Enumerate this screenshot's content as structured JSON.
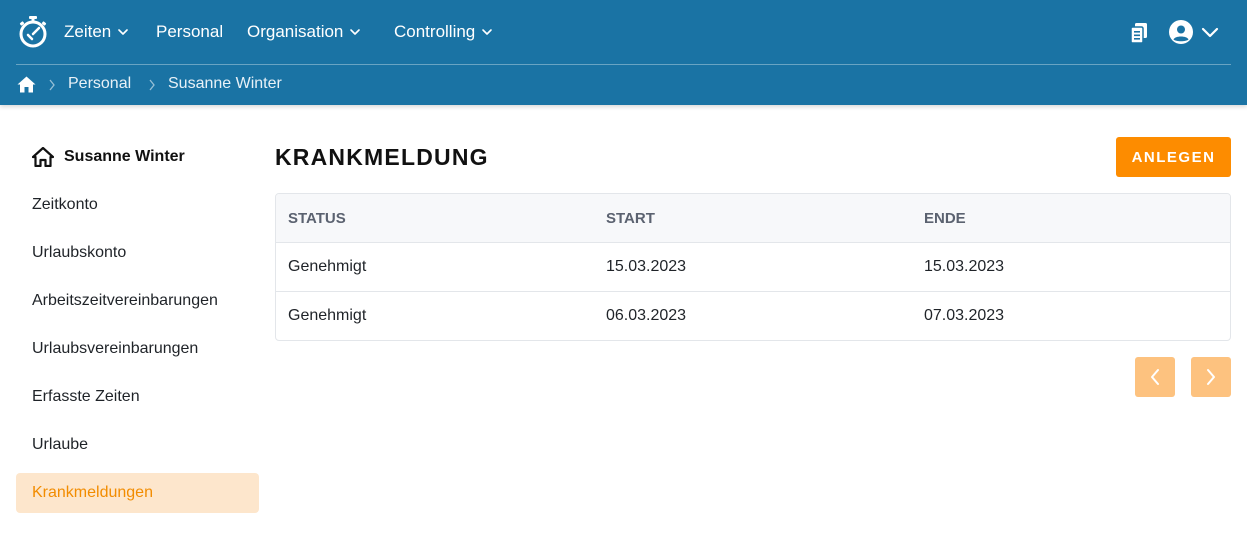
{
  "colors": {
    "header": "#1a73a4",
    "accent": "#fd8c00",
    "active_bg": "#fde6cc",
    "pager_disabled": "#fdc27f"
  },
  "nav": {
    "items": [
      {
        "label": "Zeiten",
        "has_dropdown": true
      },
      {
        "label": "Personal",
        "has_dropdown": false
      },
      {
        "label": "Organisation",
        "has_dropdown": true
      },
      {
        "label": "Controlling",
        "has_dropdown": true
      }
    ],
    "icons": [
      "clipboard-icon",
      "user-avatar-icon",
      "chevron-down-icon"
    ]
  },
  "breadcrumb": {
    "items": [
      "Personal",
      "Susanne Winter"
    ]
  },
  "sidebar": {
    "title": "Susanne Winter",
    "items": [
      {
        "label": "Zeitkonto",
        "active": false
      },
      {
        "label": "Urlaubskonto",
        "active": false
      },
      {
        "label": "Arbeitszeitvereinbarungen",
        "active": false
      },
      {
        "label": "Urlaubsvereinbarungen",
        "active": false
      },
      {
        "label": "Erfasste Zeiten",
        "active": false
      },
      {
        "label": "Urlaube",
        "active": false
      },
      {
        "label": "Krankmeldungen",
        "active": true
      }
    ]
  },
  "main": {
    "title": "KRANKMELDUNG",
    "add_label": "ANLEGEN",
    "table": {
      "headers": [
        "STATUS",
        "START",
        "ENDE"
      ],
      "rows": [
        [
          "Genehmigt",
          "15.03.2023",
          "15.03.2023"
        ],
        [
          "Genehmigt",
          "06.03.2023",
          "07.03.2023"
        ]
      ]
    }
  }
}
